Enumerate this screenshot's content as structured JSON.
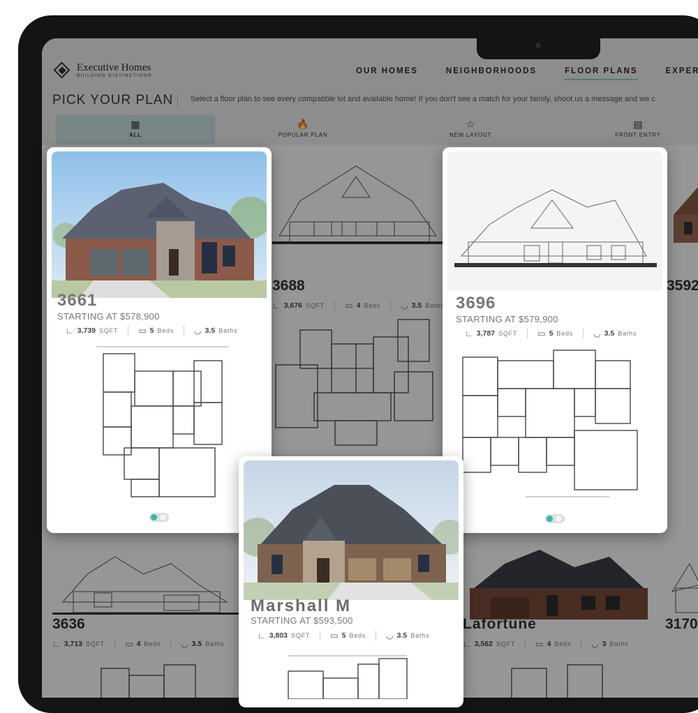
{
  "brand": {
    "name": "Executive Homes",
    "tagline": "BUILDING DISTINCTION®"
  },
  "nav": [
    {
      "label": "OUR HOMES"
    },
    {
      "label": "NEIGHBORHOODS"
    },
    {
      "label": "FLOOR PLANS",
      "active": true
    },
    {
      "label": "EXPERIEN"
    }
  ],
  "page": {
    "title": "PICK YOUR PLAN",
    "description": "Select a floor plan to see every compatible lot and available home! If you don't see a match for your family, shoot us a message and we c"
  },
  "filters": [
    {
      "label": "ALL",
      "icon": "floorplan-icon",
      "active": true
    },
    {
      "label": "POPULAR PLAN",
      "icon": "flame-icon"
    },
    {
      "label": "NEW LAYOUT",
      "icon": "star-icon"
    },
    {
      "label": "FRONT ENTRY",
      "icon": "sofa-icon"
    }
  ],
  "units": {
    "sqft": "SQFT",
    "beds": "Beds",
    "baths": "Baths"
  },
  "featured": [
    {
      "name": "3661",
      "starting": "STARTING AT $578,900",
      "sqft": "3,739",
      "beds": "5",
      "baths": "3.5"
    },
    {
      "name": "3696",
      "starting": "STARTING AT $579,900",
      "sqft": "3,787",
      "beds": "5",
      "baths": "3.5"
    },
    {
      "name": "Marshall M",
      "starting": "STARTING AT $593,500",
      "sqft": "3,803",
      "beds": "5",
      "baths": "3.5"
    }
  ],
  "background_cards": [
    {
      "name": "3688",
      "sqft": "3,676",
      "beds": "4",
      "baths": "3.5"
    },
    {
      "name": "3592",
      "sqft": "",
      "beds": "",
      "baths": ""
    },
    {
      "name": "3636",
      "sqft": "3,713",
      "beds": "4",
      "baths": "3.5"
    },
    {
      "name": "Lafortune",
      "sqft": "3,562",
      "beds": "4",
      "baths": "3"
    },
    {
      "name": "3170",
      "sqft": "",
      "beds": "",
      "baths": ""
    }
  ],
  "colors": {
    "accent": "#8fc9c7",
    "toggle": "#3bb5b0",
    "frame": "#141414",
    "brick": "#8a5a48",
    "sky": "#bcd6ec",
    "roof": "#5a6068"
  }
}
